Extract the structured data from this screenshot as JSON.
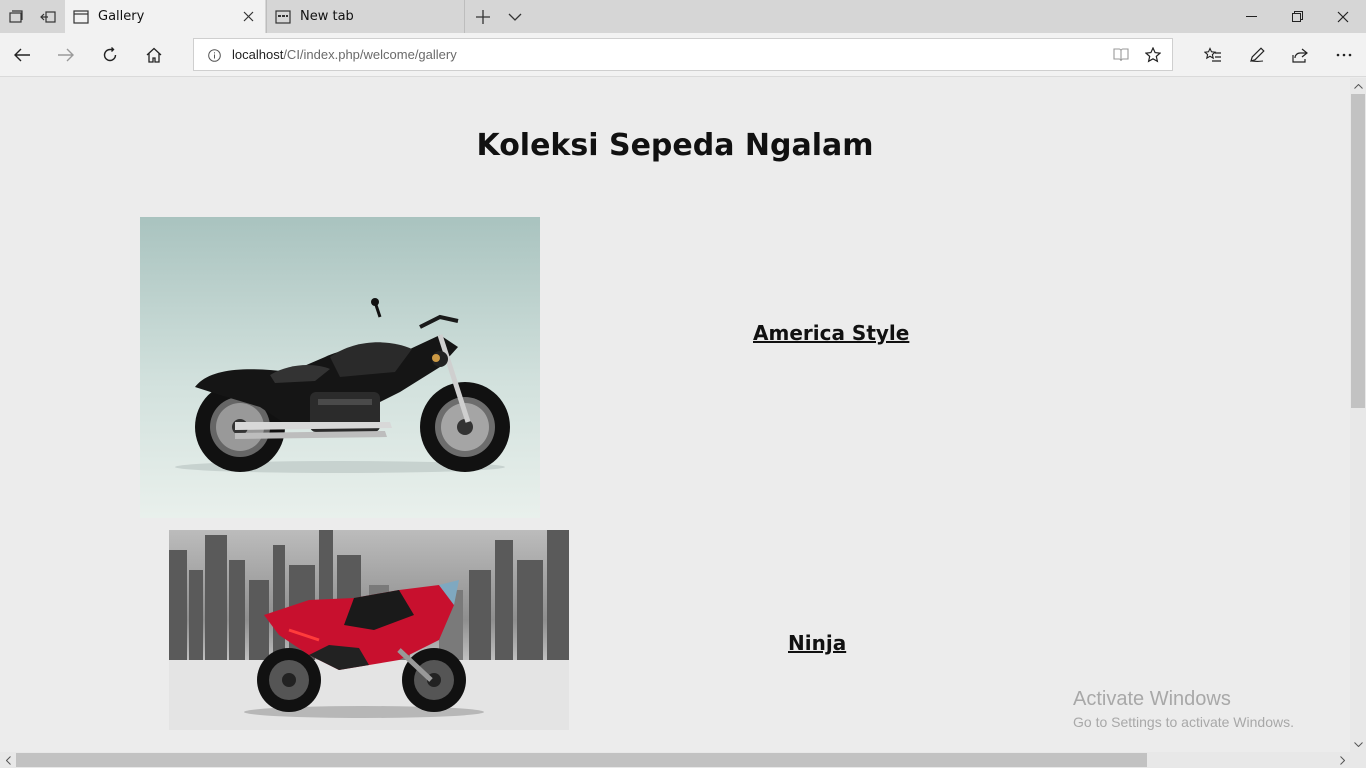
{
  "browser": {
    "tabs": [
      {
        "title": "Gallery",
        "active": true
      },
      {
        "title": "New tab",
        "active": false
      }
    ],
    "address": {
      "host": "localhost",
      "path": "/CI/index.php/welcome/gallery"
    },
    "colors": {
      "tabbar": "#d6d6d6",
      "toolbar": "#f2f2f2",
      "page_bg": "#ececec"
    }
  },
  "page": {
    "title": "Koleksi Sepeda Ngalam",
    "items": [
      {
        "name": "America Style",
        "image": "black cruiser motorcycle"
      },
      {
        "name": "Ninja",
        "image": "red sport motorcycle with city skyline"
      }
    ]
  },
  "watermark": {
    "title": "Activate Windows",
    "subtitle": "Go to Settings to activate Windows."
  }
}
